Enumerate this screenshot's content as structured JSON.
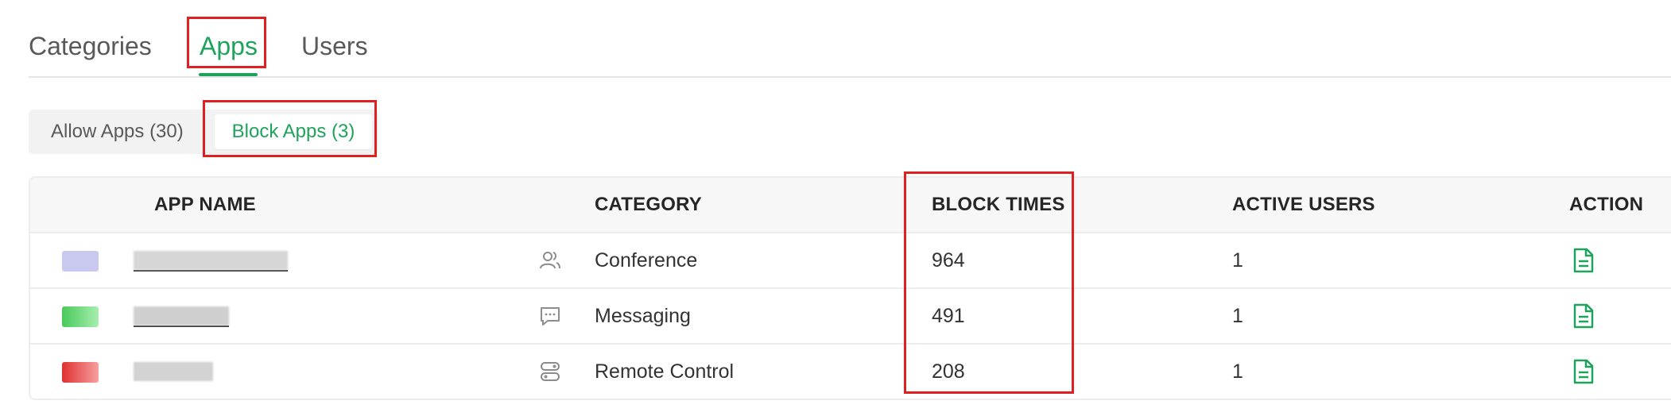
{
  "tabs": {
    "items": [
      {
        "label": "Categories"
      },
      {
        "label": "Apps"
      },
      {
        "label": "Users"
      }
    ],
    "active_index": 1
  },
  "segments": {
    "items": [
      {
        "label": "Allow Apps (30)"
      },
      {
        "label": "Block Apps (3)"
      }
    ],
    "active_index": 1
  },
  "table": {
    "headers": {
      "app_name": "APP NAME",
      "category": "CATEGORY",
      "block_times": "BLOCK TIMES",
      "active_users": "ACTIVE USERS",
      "action": "ACTION"
    },
    "rows": [
      {
        "category": "Conference",
        "block_times": "964",
        "active_users": "1",
        "category_icon": "users-icon",
        "app_color": "#c9c9f0"
      },
      {
        "category": "Messaging",
        "block_times": "491",
        "active_users": "1",
        "category_icon": "chat-bubble-icon",
        "app_color": "#7ee08a"
      },
      {
        "category": "Remote Control",
        "block_times": "208",
        "active_users": "1",
        "category_icon": "server-toggle-icon",
        "app_color": "#ef6a6a"
      }
    ]
  },
  "colors": {
    "accent": "#1fa35c",
    "highlight": "#e02020"
  }
}
